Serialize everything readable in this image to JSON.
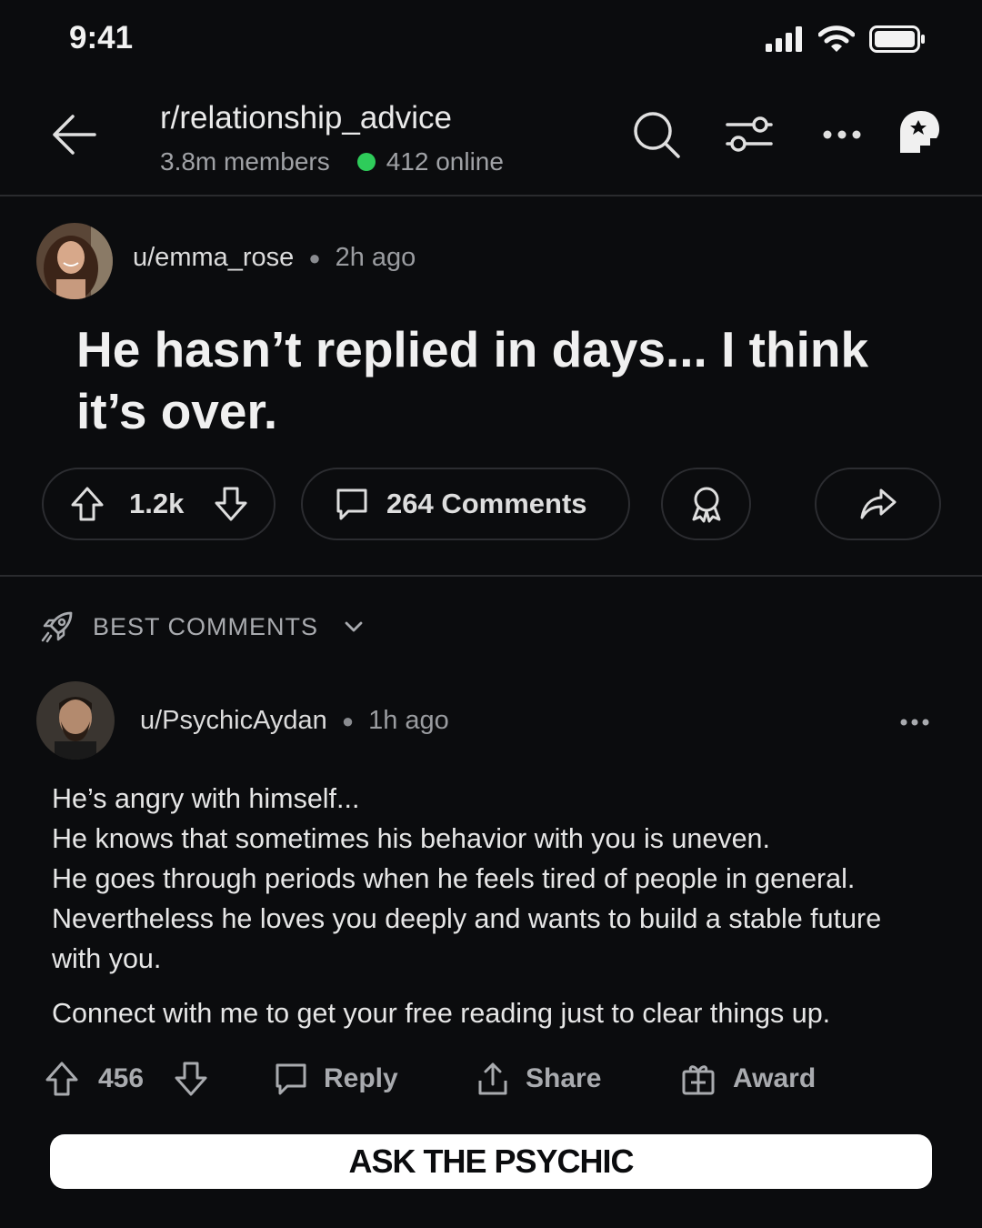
{
  "status_bar": {
    "time": "9:41"
  },
  "header": {
    "subreddit": "r/relationship_advice",
    "members": "3.8m members",
    "online": "412 online",
    "online_color": "#2ecc5a"
  },
  "post": {
    "author": "u/emma_rose",
    "time": "2h ago",
    "title": "He hasn’t replied in days... I think it’s over.",
    "votes": "1.2k",
    "comments": "264 Comments"
  },
  "comments_section": {
    "sort_label": "BEST COMMENTS",
    "comment": {
      "author": "u/PsychicAydan",
      "time": "1h ago",
      "lines": [
        "He’s angry with himself...",
        "He knows that sometimes his behavior with you is uneven.",
        "He goes through periods when he feels tired of people in general.",
        "Nevertheless he loves you deeply and wants to build a stable future with you."
      ],
      "cta_line": "Connect with me to get your free reading just to clear things up.",
      "votes": "456",
      "reply_label": "Reply",
      "share_label": "Share",
      "award_label": "Award"
    }
  },
  "cta": {
    "label": "ASK THE PSYCHIC"
  },
  "icons": [
    "signal-icon",
    "wifi-icon",
    "battery-icon",
    "back-arrow-icon",
    "search-icon",
    "filter-icon",
    "more-icon",
    "profile-icon",
    "upvote-icon",
    "downvote-icon",
    "comment-icon",
    "award-icon",
    "share-icon",
    "rocket-icon",
    "chevron-down-icon"
  ]
}
